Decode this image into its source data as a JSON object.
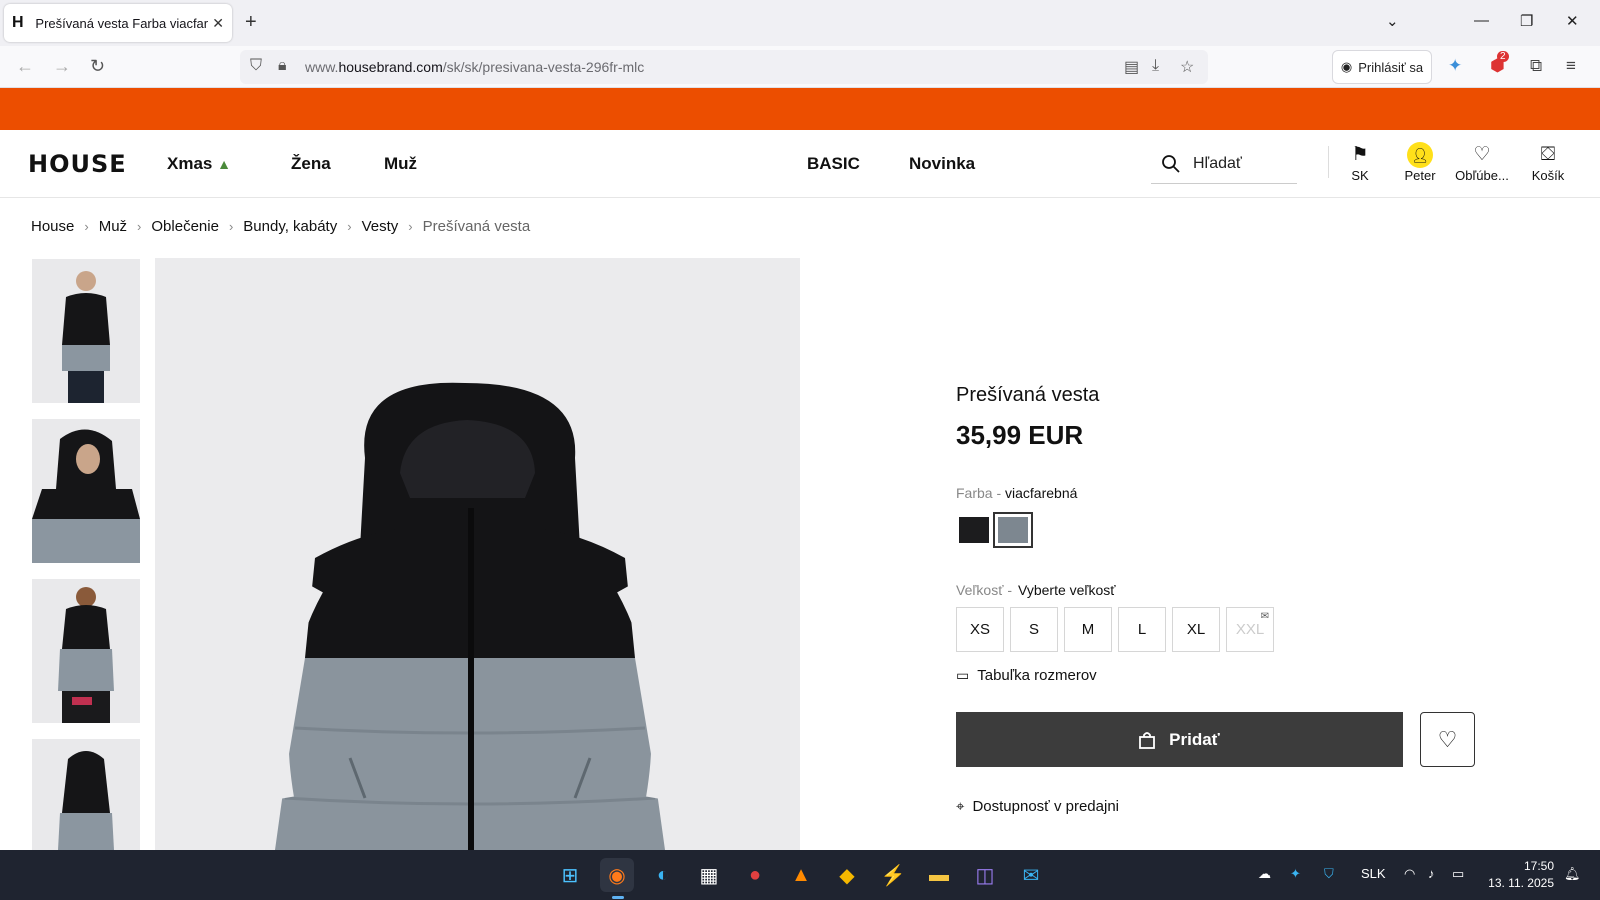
{
  "browser": {
    "tab_title": "Prešívaná vesta Farba viacfarebná",
    "tab_favicon": "H",
    "url_prefix": "www.",
    "url_domain": "housebrand.com",
    "url_path": "/sk/sk/presivana-vesta-296fr-mlc",
    "signin_label": "Prihlásiť sa",
    "extension_badge": "2"
  },
  "site": {
    "logo": "HOUSE",
    "promo_color": "#ec4e00",
    "menu": [
      {
        "label": "Xmas"
      },
      {
        "label": "Žena"
      },
      {
        "label": "Muž"
      },
      {
        "label": "BASIC"
      },
      {
        "label": "Novinka"
      }
    ],
    "search_placeholder": "Hľadať",
    "header_items": {
      "country": "SK",
      "account": "Peter",
      "favorites": "Obľúbe...",
      "cart": "Košík"
    }
  },
  "breadcrumb": [
    "House",
    "Muž",
    "Oblečenie",
    "Bundy, kabáty",
    "Vesty",
    "Prešívaná vesta"
  ],
  "product": {
    "name": "Prešívaná vesta",
    "price": "35,99 EUR",
    "color_label": "Farba - ",
    "color_value": "viacfarebná",
    "swatches": [
      {
        "color": "#1c1c1e",
        "selected": false
      },
      {
        "color": "#7d8790",
        "selected": true
      }
    ],
    "size_label": "Veľkosť -",
    "size_value": "Vyberte veľkosť",
    "sizes": [
      {
        "label": "XS",
        "available": true
      },
      {
        "label": "S",
        "available": true
      },
      {
        "label": "M",
        "available": true
      },
      {
        "label": "L",
        "available": true
      },
      {
        "label": "XL",
        "available": true
      },
      {
        "label": "XXL",
        "available": false
      }
    ],
    "size_chart": "Tabuľka rozmerov",
    "add_button": "Pridať",
    "availability": "Dostupnosť v predajni"
  },
  "taskbar": {
    "language": "SLK",
    "time": "17:50",
    "date": "13. 11. 2025"
  }
}
